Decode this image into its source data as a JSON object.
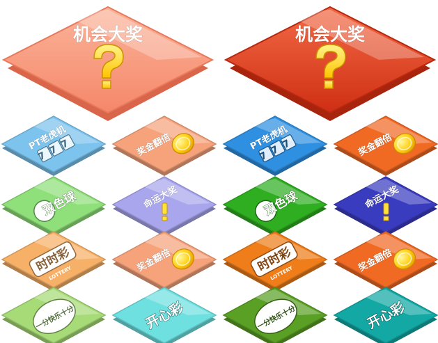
{
  "palette": {
    "big_light": "#f89a7c",
    "big_dark": "#e4411f",
    "question_mark": "#ffe23a"
  },
  "big_tiles": [
    {
      "label": "机会大奖",
      "icon": "question-mark-icon",
      "variant": "light"
    },
    {
      "label": "机会大奖",
      "icon": "question-mark-icon",
      "variant": "dark"
    }
  ],
  "small_tiles": [
    {
      "label": "PT老虎机",
      "sub": "777",
      "icon": "slot-777-icon",
      "variant": "light",
      "color": "#7cc3ee"
    },
    {
      "label": "奖金翻倍",
      "icon": "gold-coin-icon",
      "variant": "light",
      "color": "#f6a37c"
    },
    {
      "label": "PT老虎机",
      "sub": "777",
      "icon": "slot-777-icon",
      "variant": "dark",
      "color": "#2f8fe0"
    },
    {
      "label": "奖金翻倍",
      "icon": "gold-coin-icon",
      "variant": "dark",
      "color": "#f06a24"
    },
    {
      "label": "双色球",
      "icon": "lottery-ball-icon",
      "variant": "light",
      "color": "#8fe07a"
    },
    {
      "label": "命运大奖",
      "icon": "exclamation-icon",
      "variant": "light",
      "color": "#a9a6ee"
    },
    {
      "label": "双色球",
      "icon": "lottery-ball-icon",
      "variant": "dark",
      "color": "#2fae21"
    },
    {
      "label": "命运大奖",
      "icon": "exclamation-icon",
      "variant": "dark",
      "color": "#3a3cc0"
    },
    {
      "label": "时时彩",
      "sub": "LOTTERY",
      "icon": "lottery-badge-icon",
      "variant": "light",
      "color": "#f7b067"
    },
    {
      "label": "奖金翻倍",
      "icon": "gold-coin-icon",
      "variant": "light",
      "color": "#f6a37c"
    },
    {
      "label": "时时彩",
      "sub": "LOTTERY",
      "icon": "lottery-badge-icon",
      "variant": "dark",
      "color": "#ee7d1a"
    },
    {
      "label": "奖金翻倍",
      "icon": "gold-coin-icon",
      "variant": "dark",
      "color": "#f06a24"
    },
    {
      "label": "一分快乐十分",
      "icon": "lucky-ten-icon",
      "variant": "light",
      "color": "#a7db78"
    },
    {
      "label": "开心彩",
      "icon": "happy-lottery-icon",
      "variant": "light",
      "color": "#6fe0e0"
    },
    {
      "label": "一分快乐十分",
      "icon": "lucky-ten-icon",
      "variant": "dark",
      "color": "#5aa025"
    },
    {
      "label": "开心彩",
      "icon": "happy-lottery-icon",
      "variant": "dark",
      "color": "#13a8a4"
    }
  ]
}
